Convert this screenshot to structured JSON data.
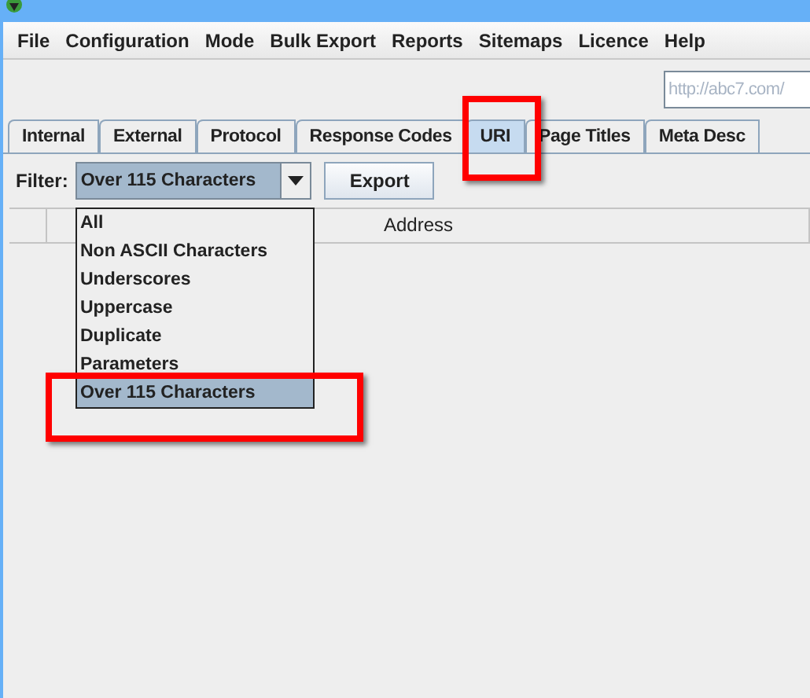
{
  "menu": [
    "File",
    "Configuration",
    "Mode",
    "Bulk Export",
    "Reports",
    "Sitemaps",
    "Licence",
    "Help"
  ],
  "url_field": {
    "placeholder": "http://abc7.com/"
  },
  "tabs": [
    {
      "label": "Internal",
      "selected": false,
      "highlighted": false
    },
    {
      "label": "External",
      "selected": false,
      "highlighted": false
    },
    {
      "label": "Protocol",
      "selected": false,
      "highlighted": false
    },
    {
      "label": "Response Codes",
      "selected": false,
      "highlighted": false
    },
    {
      "label": "URI",
      "selected": true,
      "highlighted": true
    },
    {
      "label": "Page Titles",
      "selected": false,
      "highlighted": false
    },
    {
      "label": "Meta Desc",
      "selected": false,
      "highlighted": false
    }
  ],
  "filter": {
    "label": "Filter:",
    "value": "Over 115 Characters",
    "expanded": true,
    "options": [
      {
        "label": "All",
        "selected": false,
        "highlighted": false
      },
      {
        "label": "Non ASCII Characters",
        "selected": false,
        "highlighted": false
      },
      {
        "label": "Underscores",
        "selected": false,
        "highlighted": false
      },
      {
        "label": "Uppercase",
        "selected": false,
        "highlighted": false
      },
      {
        "label": "Duplicate",
        "selected": false,
        "highlighted": false
      },
      {
        "label": "Parameters",
        "selected": false,
        "highlighted": false
      },
      {
        "label": "Over 115 Characters",
        "selected": true,
        "highlighted": true
      }
    ]
  },
  "export_button": "Export",
  "table": {
    "columns": [
      "Address"
    ]
  }
}
